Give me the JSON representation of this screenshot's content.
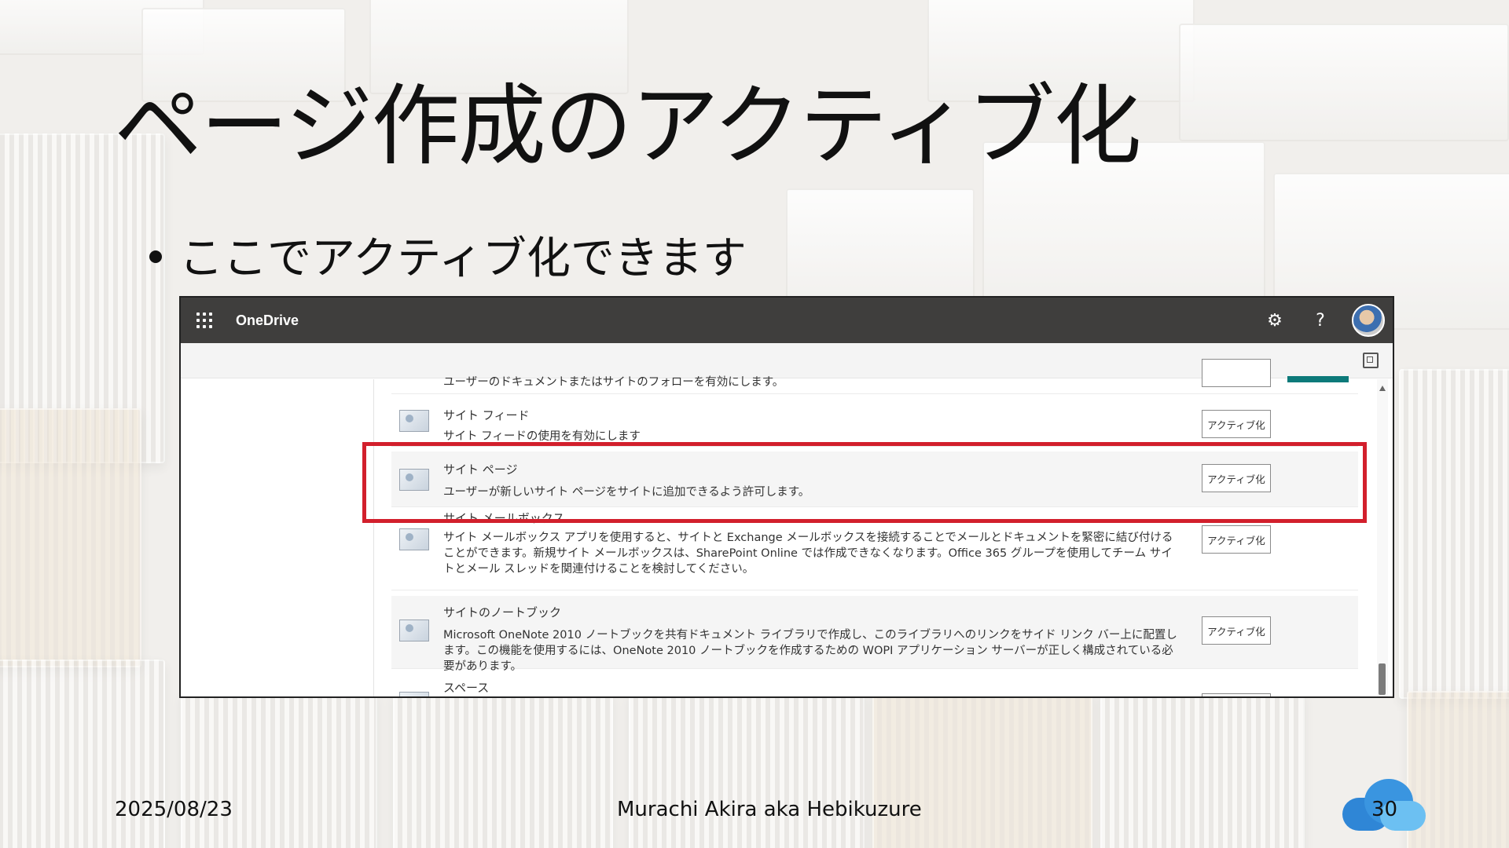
{
  "slide": {
    "title": "ページ作成のアクティブ化",
    "bullet": "ここでアクティブ化できます",
    "footer_date": "2025/08/23",
    "footer_author": "Murachi Akira aka Hebikuzure",
    "page_number": "30"
  },
  "app": {
    "brand": "OneDrive",
    "settings_icon": "⚙",
    "help_icon": "?"
  },
  "features": {
    "button_label": "アクティブ化",
    "partial_top_desc": "ユーザーのドキュメントまたはサイトのフォローを有効にします。",
    "site_feed_name": "サイト フィード",
    "site_feed_desc": "サイト フィードの使用を有効にします",
    "site_pages_name": "サイト ページ",
    "site_pages_desc": "ユーザーが新しいサイト ページをサイトに追加できるよう許可します。",
    "site_mailbox_name": "サイト メールボックス",
    "site_mailbox_desc": "サイト メールボックス アプリを使用すると、サイトと Exchange メールボックスを接続することでメールとドキュメントを緊密に結び付けることができます。新規サイト メールボックスは、SharePoint Online では作成できなくなります。Office 365 グループを使用してチーム サイトとメール スレッドを関連付けることを検討してください。",
    "notebook_name": "サイトのノートブック",
    "notebook_desc": "Microsoft OneNote 2010 ノートブックを共有ドキュメント ライブラリで作成し、このライブラリへのリンクをサイド リンク バー上に配置します。この機能を使用するには、OneNote 2010 ノートブックを作成するための WOPI アプリケーション サーバーが正しく構成されている必要があります。",
    "spaces_name": "スペース"
  },
  "colors": {
    "topbar": "#3f3e3d",
    "highlight": "#d21f2c",
    "accent_teal": "#0c7a7a"
  }
}
